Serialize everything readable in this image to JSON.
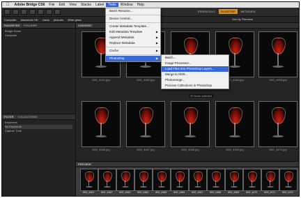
{
  "menubar": {
    "app_name": "Adobe Bridge CS6",
    "items": [
      "File",
      "Edit",
      "View",
      "Stacks",
      "Label",
      "Tools",
      "Window",
      "Help"
    ],
    "active_item": "Tools"
  },
  "toolbar": {
    "workspaces": [
      "ESSENTIALS",
      "FILMSTRIP",
      "METADATA"
    ],
    "active_workspace": "FILMSTRIP",
    "sort_label": "Sort by Filename"
  },
  "pathbar": {
    "crumbs": [
      "Computer",
      "Macintosh HD",
      "Users",
      "pictures",
      "Wine glass"
    ]
  },
  "left_panel": {
    "tabs": [
      "FAVORITES",
      "FOLDERS"
    ],
    "items": [
      "Bridge Home",
      "Computer"
    ],
    "filter_tabs": [
      "FILTER",
      "COLLECTIONS"
    ],
    "filter_items": [
      "Keywords",
      "No Keywords",
      "Capture Time"
    ]
  },
  "content": {
    "tab_label": "CONTENT",
    "hover_label": "20 items selected",
    "row1_labels": [
      "IMG_4461.jpg",
      "IMG_4462.jpg",
      "IMG_4463.jpg",
      "IMG_4464.jpg",
      "IMG_4465.jpg"
    ],
    "row2_labels": [
      "IMG_4466.jpg",
      "IMG_4467.jpg",
      "IMG_4468.jpg",
      "IMG_4469.jpg",
      "IMG_4470.jpg"
    ]
  },
  "filmstrip": {
    "tab_label": "PREVIEW",
    "labels": [
      "IMG_4461",
      "IMG_4462",
      "IMG_4463",
      "IMG_4464",
      "IMG_4465",
      "IMG_4466",
      "IMG_4467",
      "IMG_4468",
      "IMG_4469",
      "IMG_4470",
      "IMG_4471",
      "IMG_4472"
    ]
  },
  "tools_menu": {
    "items": [
      {
        "label": "Batch Rename...",
        "submenu": false
      },
      {
        "label": "Device Central...",
        "submenu": false
      },
      {
        "label": "Create Metadata Template...",
        "submenu": false
      },
      {
        "label": "Edit Metadata Template",
        "submenu": true
      },
      {
        "label": "Append Metadata",
        "submenu": true
      },
      {
        "label": "Replace Metadata",
        "submenu": true
      },
      {
        "label": "Cache",
        "submenu": true
      },
      {
        "label": "Photoshop",
        "submenu": true
      }
    ],
    "highlighted": "Photoshop"
  },
  "photoshop_menu": {
    "items": [
      "Batch...",
      "Image Processor...",
      "Load Files into Photoshop Layers...",
      "Merge to HDR...",
      "Photomerge...",
      "Process Collections in Photoshop"
    ],
    "highlighted": "Load Files into Photoshop Layers..."
  },
  "colors": {
    "menu_highlight": "#3569d8",
    "workspace_accent": "#d88b1e",
    "panel_background": "#1e1e1e"
  }
}
